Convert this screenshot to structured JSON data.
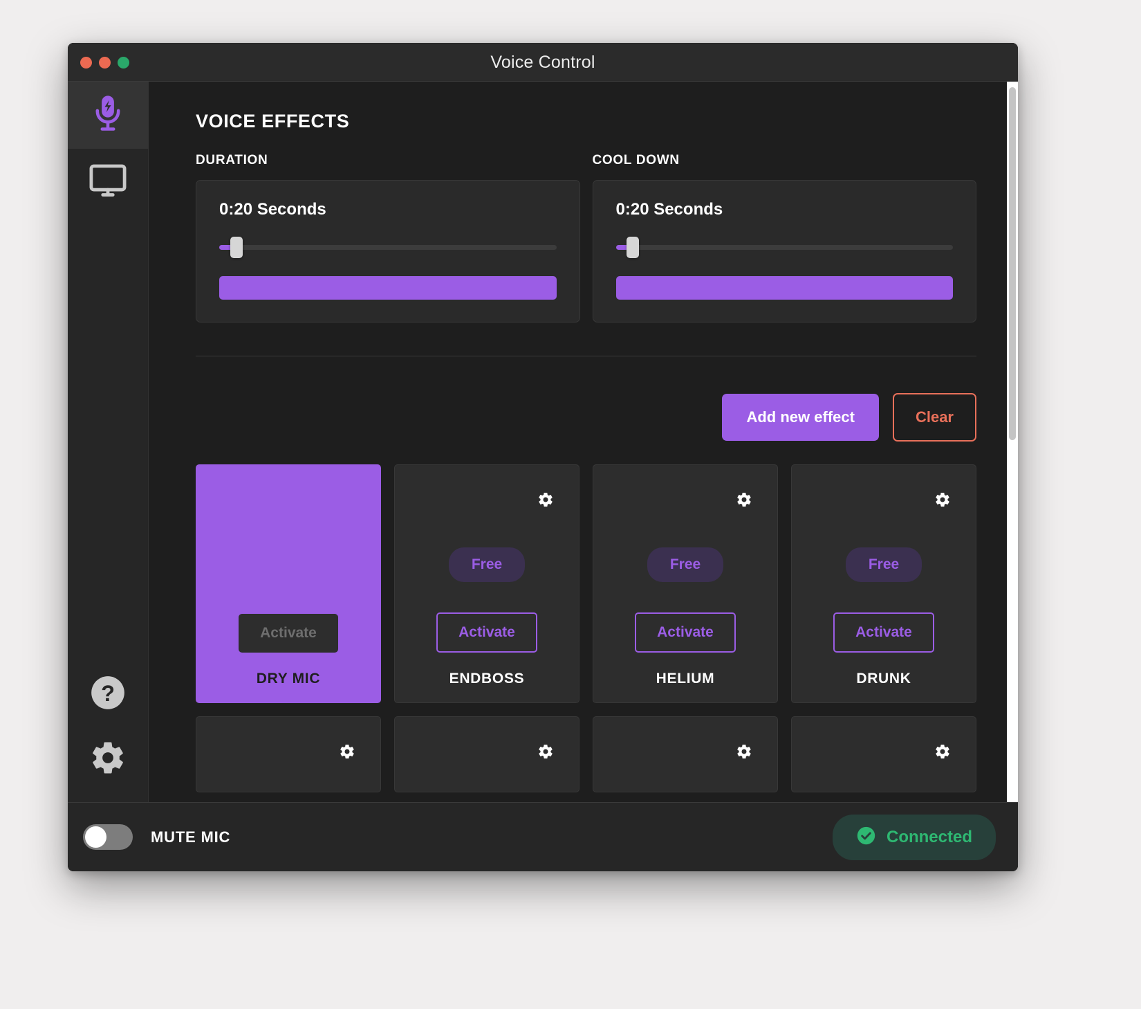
{
  "window": {
    "title": "Voice Control",
    "traffic_lights": [
      "close-red",
      "minimize-red",
      "maximize-green"
    ]
  },
  "sidebar": {
    "items": [
      {
        "icon": "microphone-bolt-icon",
        "name": "voice-effects",
        "active": true
      },
      {
        "icon": "monitor-icon",
        "name": "display",
        "active": false
      }
    ],
    "bottom_items": [
      {
        "icon": "help-question-icon",
        "name": "help"
      },
      {
        "icon": "gear-icon",
        "name": "settings"
      }
    ]
  },
  "main": {
    "heading": "VOICE EFFECTS",
    "duration": {
      "label": "DURATION",
      "value": "0:20 Seconds",
      "slider_percent": 4,
      "progress_percent": 100
    },
    "cooldown": {
      "label": "COOL DOWN",
      "value": "0:20 Seconds",
      "slider_percent": 4,
      "progress_percent": 100
    },
    "actions": {
      "add_label": "Add new effect",
      "clear_label": "Clear"
    },
    "effects": [
      {
        "name": "DRY MIC",
        "badge": null,
        "activate_label": "Activate",
        "selected": true,
        "has_gear": false
      },
      {
        "name": "ENDBOSS",
        "badge": "Free",
        "activate_label": "Activate",
        "selected": false,
        "has_gear": true
      },
      {
        "name": "HELIUM",
        "badge": "Free",
        "activate_label": "Activate",
        "selected": false,
        "has_gear": true
      },
      {
        "name": "DRUNK",
        "badge": "Free",
        "activate_label": "Activate",
        "selected": false,
        "has_gear": true
      }
    ],
    "effects_row2": [
      {
        "has_gear": true
      },
      {
        "has_gear": true
      },
      {
        "has_gear": true
      },
      {
        "has_gear": true
      }
    ]
  },
  "footer": {
    "mute_label": "MUTE MIC",
    "mute_on": false,
    "status_text": "Connected",
    "status_icon": "check-circle-icon"
  },
  "colors": {
    "accent_purple": "#9b5de5",
    "danger_coral": "#e8705a",
    "status_green": "#2eb872",
    "panel_bg": "#2a2a2a",
    "window_bg": "#1e1e1e"
  }
}
